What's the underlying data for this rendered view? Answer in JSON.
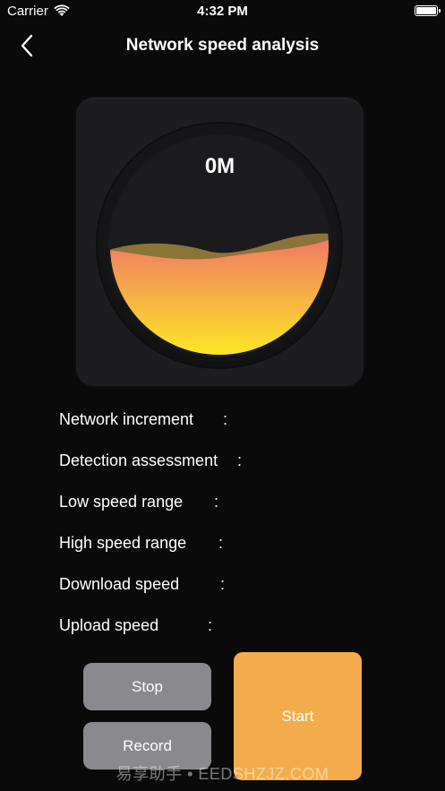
{
  "status_bar": {
    "carrier": "Carrier",
    "time": "4:32 PM"
  },
  "nav": {
    "title": "Network speed analysis",
    "back_icon": "chevron-left-icon"
  },
  "gauge": {
    "value": "0M"
  },
  "info": {
    "rows": [
      {
        "label": "Network increment",
        "value": ""
      },
      {
        "label": "Detection assessment",
        "value": ""
      },
      {
        "label": "Low speed range",
        "value": ""
      },
      {
        "label": "High speed range",
        "value": ""
      },
      {
        "label": "Download speed",
        "value": ""
      },
      {
        "label": "Upload speed",
        "value": ""
      }
    ],
    "separator": ":"
  },
  "buttons": {
    "stop": "Stop",
    "record": "Record",
    "start": "Start"
  },
  "watermark": "易享助手 • EEDSHZJZ.COM",
  "colors": {
    "background": "#0a0a0a",
    "card": "#1d1d1f",
    "button_gray": "#8a8a8e",
    "button_start": "#f4ad4c",
    "wave_top": "#f07a65",
    "wave_bottom": "#fff21e",
    "wave_back": "#8a7438"
  }
}
